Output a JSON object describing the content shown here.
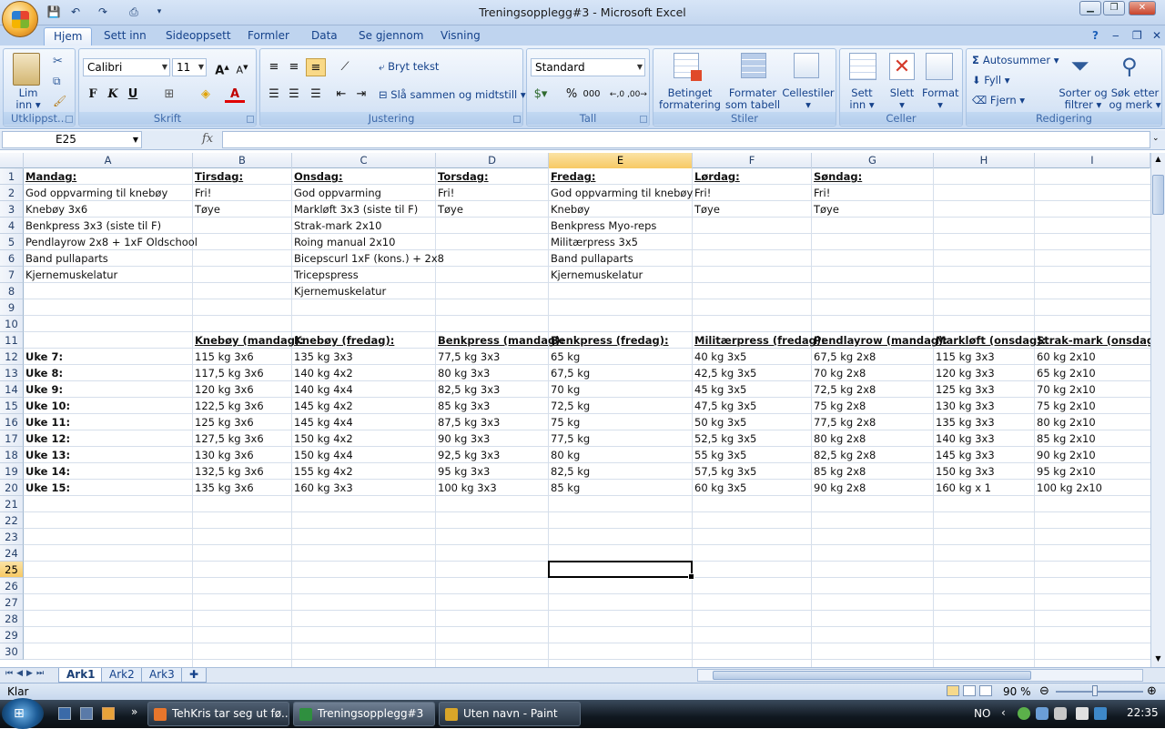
{
  "window": {
    "title": "Treningsopplegg#3 - Microsoft Excel"
  },
  "qat": {
    "save": "💾",
    "undo": "↶",
    "redo": "↷"
  },
  "ribbon": {
    "tabs": [
      "Hjem",
      "Sett inn",
      "Sideoppsett",
      "Formler",
      "Data",
      "Se gjennom",
      "Visning"
    ],
    "active_tab": "Hjem",
    "clipboard": {
      "group": "Utklippst...",
      "paste_1": "Lim",
      "paste_2": "inn ▾"
    },
    "font": {
      "group": "Skrift",
      "name": "Calibri",
      "size": "11",
      "bold": "F",
      "italic": "K",
      "underline": "U"
    },
    "alignment": {
      "group": "Justering",
      "wrap": "Bryt tekst",
      "merge": "Slå sammen og midtstill"
    },
    "number": {
      "group": "Tall",
      "format": "Standard",
      "percent": "%",
      "thousands": "000"
    },
    "styles": {
      "group": "Stiler",
      "cond_1": "Betinget",
      "cond_2": "formatering ▾",
      "table_1": "Formater",
      "table_2": "som tabell ▾",
      "cell_1": "Cellestiler",
      "cell_2": "▾"
    },
    "cells": {
      "group": "Celler",
      "insert_1": "Sett",
      "insert_2": "inn ▾",
      "delete_1": "Slett",
      "delete_2": "▾",
      "format_1": "Format",
      "format_2": "▾"
    },
    "editing": {
      "group": "Redigering",
      "autosum": "Autosummer ▾",
      "fill": "Fyll ▾",
      "clear": "Fjern ▾",
      "sort_1": "Sorter og",
      "sort_2": "filtrer ▾",
      "find_1": "Søk etter",
      "find_2": "og merk ▾"
    }
  },
  "formula_bar": {
    "name_box": "E25",
    "fx": "fx",
    "formula": ""
  },
  "columns": [
    "A",
    "B",
    "C",
    "D",
    "E",
    "F",
    "G",
    "H",
    "I"
  ],
  "rows": [
    "1",
    "2",
    "3",
    "4",
    "5",
    "6",
    "7",
    "8",
    "9",
    "10",
    "11",
    "12",
    "13",
    "14",
    "15",
    "16",
    "17",
    "18",
    "19",
    "20",
    "21",
    "22",
    "23",
    "24",
    "25",
    "26",
    "27",
    "28",
    "29",
    "30"
  ],
  "selected": {
    "col": "E",
    "row": "25"
  },
  "sheet": {
    "schedule": [
      [
        "Mandag:",
        "Tirsdag:",
        "Onsdag:",
        "Torsdag:",
        "Fredag:",
        "Lørdag:",
        "Søndag:"
      ],
      [
        "God oppvarming til knebøy",
        "Fri!",
        "God oppvarming",
        "Fri!",
        "God oppvarming til knebøy",
        "Fri!",
        "Fri!"
      ],
      [
        "Knebøy 3x6",
        "Tøye",
        "Markløft 3x3 (siste til F)",
        "Tøye",
        "Knebøy",
        "Tøye",
        "Tøye"
      ],
      [
        "Benkpress 3x3 (siste til F)",
        "",
        "Strak-mark 2x10",
        "",
        "Benkpress Myo-reps",
        "",
        ""
      ],
      [
        "Pendlayrow 2x8 + 1xF Oldschool",
        "",
        "Roing manual 2x10",
        "",
        "Militærpress 3x5",
        "",
        ""
      ],
      [
        "Band pullaparts",
        "",
        "Bicepscurl 1xF (kons.) + 2x8",
        "",
        "Band pullaparts",
        "",
        ""
      ],
      [
        "Kjernemuskelatur",
        "",
        "Tricepspress",
        "",
        "Kjernemuskelatur",
        "",
        ""
      ],
      [
        "",
        "",
        "Kjernemuskelatur",
        "",
        "",
        "",
        ""
      ]
    ],
    "progress_header": [
      "",
      "Knebøy (mandag):",
      "Knebøy (fredag):",
      "Benkpress (mandag):",
      "Benkpress (fredag):",
      "Militærpress (fredag):",
      "Pendlayrow (mandag):",
      "Markløft (onsdag):",
      "Strak-mark (onsdag):"
    ],
    "progress": [
      [
        "Uke 7:",
        "115 kg 3x6",
        "135 kg 3x3",
        "77,5 kg 3x3",
        "65 kg",
        "40 kg 3x5",
        "67,5 kg 2x8",
        "115 kg 3x3",
        "60 kg 2x10"
      ],
      [
        "Uke 8:",
        "117,5 kg 3x6",
        "140 kg 4x2",
        "80 kg 3x3",
        "67,5 kg",
        "42,5 kg 3x5",
        "70 kg 2x8",
        "120 kg 3x3",
        "65 kg 2x10"
      ],
      [
        "Uke 9:",
        "120 kg 3x6",
        "140 kg 4x4",
        "82,5 kg 3x3",
        "70 kg",
        "45 kg 3x5",
        "72,5 kg 2x8",
        "125 kg 3x3",
        "70 kg 2x10"
      ],
      [
        "Uke 10:",
        "122,5 kg 3x6",
        "145 kg 4x2",
        "85 kg 3x3",
        "72,5 kg",
        "47,5 kg 3x5",
        "75 kg 2x8",
        "130 kg 3x3",
        "75 kg 2x10"
      ],
      [
        "Uke 11:",
        "125 kg 3x6",
        "145 kg 4x4",
        "87,5 kg 3x3",
        "75 kg",
        "50 kg 3x5",
        "77,5 kg 2x8",
        "135 kg 3x3",
        "80 kg 2x10"
      ],
      [
        "Uke 12:",
        "127,5 kg 3x6",
        "150 kg 4x2",
        "90 kg 3x3",
        "77,5 kg",
        "52,5 kg 3x5",
        "80 kg 2x8",
        "140 kg 3x3",
        "85 kg 2x10"
      ],
      [
        "Uke 13:",
        "130 kg 3x6",
        "150 kg 4x4",
        "92,5 kg 3x3",
        "80 kg",
        "55 kg 3x5",
        "82,5 kg 2x8",
        "145 kg 3x3",
        "90 kg 2x10"
      ],
      [
        "Uke 14:",
        "132,5 kg 3x6",
        "155 kg 4x2",
        "95 kg 3x3",
        "82,5 kg",
        "57,5 kg 3x5",
        "85 kg 2x8",
        "150 kg 3x3",
        "95 kg 2x10"
      ],
      [
        "Uke 15:",
        "135 kg 3x6",
        "160 kg 3x3",
        "100 kg 3x3",
        "85 kg",
        "60 kg 3x5",
        "90 kg 2x8",
        "160 kg x 1",
        "100 kg 2x10"
      ]
    ]
  },
  "sheets": [
    "Ark1",
    "Ark2",
    "Ark3"
  ],
  "active_sheet": "Ark1",
  "status": {
    "text": "Klar",
    "zoom": "90 %"
  },
  "taskbar": {
    "items": [
      {
        "label": "TehKris tar seg ut fø...",
        "color": "#e8762c"
      },
      {
        "label": "Treningsopplegg#3",
        "color": "#2f8f3f"
      },
      {
        "label": "Uten navn - Paint",
        "color": "#d9a629"
      }
    ],
    "active": "Treningsopplegg#3",
    "lang": "NO",
    "clock": "22:35"
  }
}
